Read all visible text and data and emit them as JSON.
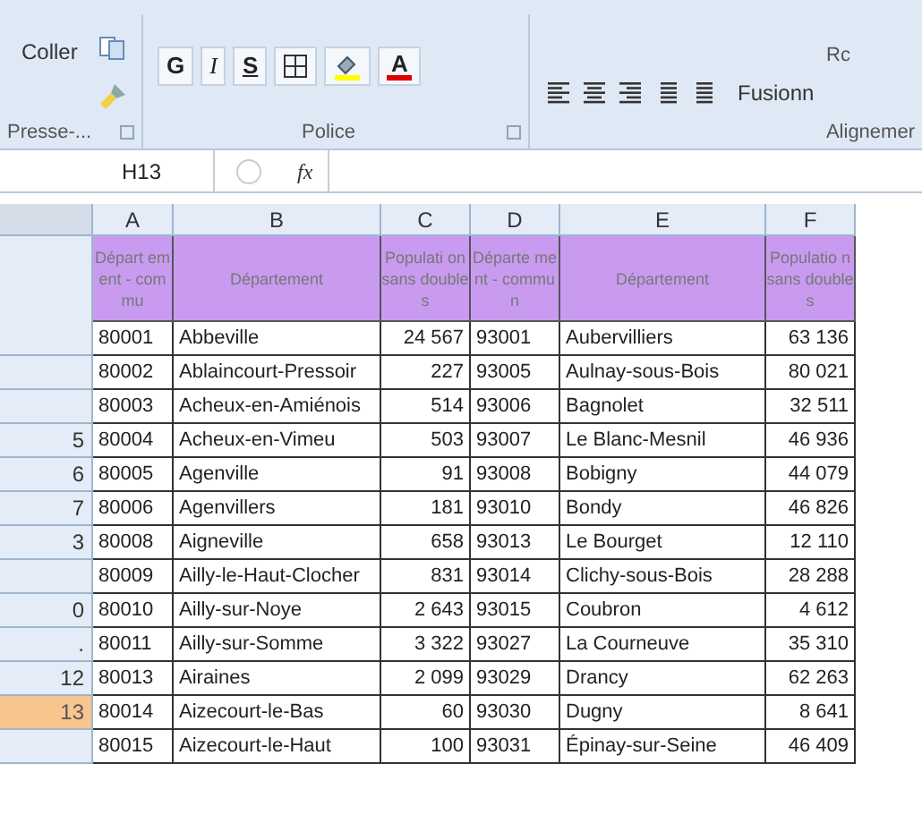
{
  "ribbon": {
    "clipboard": {
      "paste": "Coller",
      "label": "Presse-..."
    },
    "font": {
      "label": "Police",
      "buttons": [
        {
          "kind": "bold",
          "text": "G"
        },
        {
          "kind": "italic",
          "text": "I"
        },
        {
          "kind": "underline",
          "text": "S"
        },
        {
          "kind": "borders"
        },
        {
          "kind": "fill"
        },
        {
          "kind": "fontcolor",
          "text": "A"
        }
      ]
    },
    "alignment": {
      "label": "Alignemer",
      "merge": "Fusionn",
      "wrap": "Rc"
    }
  },
  "formula_bar": {
    "name_box": "H13",
    "fx": "fx"
  },
  "sheet": {
    "columns": [
      "A",
      "B",
      "C",
      "D",
      "E",
      "F"
    ],
    "headers": [
      "Départ ement - commu",
      "Département",
      "Populati on sans doubles",
      "Départe ment - commun",
      "Département",
      "Populatio n sans doubles"
    ],
    "rows": [
      {
        "number": "",
        "selected": false,
        "cells": [
          "80001",
          "Abbeville",
          "24 567",
          "93001",
          "Aubervilliers",
          "63 136"
        ]
      },
      {
        "number": "",
        "selected": false,
        "cells": [
          "80002",
          "Ablaincourt-Pressoir",
          "227",
          "93005",
          "Aulnay-sous-Bois",
          "80 021"
        ]
      },
      {
        "number": "",
        "selected": false,
        "cells": [
          "80003",
          "Acheux-en-Amiénois",
          "514",
          "93006",
          "Bagnolet",
          "32 511"
        ]
      },
      {
        "number": "5",
        "selected": false,
        "cells": [
          "80004",
          "Acheux-en-Vimeu",
          "503",
          "93007",
          "Le Blanc-Mesnil",
          "46 936"
        ]
      },
      {
        "number": "6",
        "selected": false,
        "cells": [
          "80005",
          "Agenville",
          "91",
          "93008",
          "Bobigny",
          "44 079"
        ]
      },
      {
        "number": "7",
        "selected": false,
        "cells": [
          "80006",
          "Agenvillers",
          "181",
          "93010",
          "Bondy",
          "46 826"
        ]
      },
      {
        "number": "3",
        "selected": false,
        "cells": [
          "80008",
          "Aigneville",
          "658",
          "93013",
          "Le Bourget",
          "12 110"
        ]
      },
      {
        "number": "",
        "selected": false,
        "cells": [
          "80009",
          "Ailly-le-Haut-Clocher",
          "831",
          "93014",
          "Clichy-sous-Bois",
          "28 288"
        ]
      },
      {
        "number": "0",
        "selected": false,
        "cells": [
          "80010",
          "Ailly-sur-Noye",
          "2 643",
          "93015",
          "Coubron",
          "4 612"
        ]
      },
      {
        "number": ".",
        "selected": false,
        "cells": [
          "80011",
          "Ailly-sur-Somme",
          "3 322",
          "93027",
          "La Courneuve",
          "35 310"
        ]
      },
      {
        "number": "12",
        "selected": false,
        "cells": [
          "80013",
          "Airaines",
          "2 099",
          "93029",
          "Drancy",
          "62 263"
        ]
      },
      {
        "number": "13",
        "selected": true,
        "cells": [
          "80014",
          "Aizecourt-le-Bas",
          "60",
          "93030",
          "Dugny",
          "8 641"
        ]
      },
      {
        "number": "",
        "selected": false,
        "cells": [
          "80015",
          "Aizecourt-le-Haut",
          "100",
          "93031",
          "Épinay-sur-Seine",
          "46 409"
        ]
      }
    ]
  }
}
